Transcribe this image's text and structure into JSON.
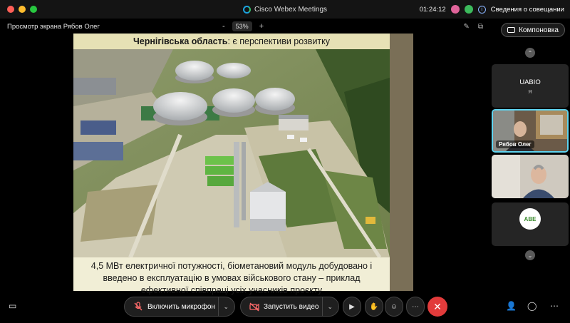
{
  "window": {
    "app_title": "Cisco Webex Meetings",
    "timer": "01:24:12",
    "meeting_info": "Сведения о совещании"
  },
  "share": {
    "label": "Просмотр экрана Рябов Олег",
    "zoom_minus": "-",
    "zoom_value": "53%",
    "zoom_plus": "+"
  },
  "layout_button": "Компоновка",
  "slide": {
    "title_bold": "Чернігівська область",
    "title_rest": ": є перспективи розвитку",
    "caption": [
      "4,5 МВт електричної потужності, біометановий модуль добудовано і",
      "введено в експлуатацію в умовах військового стану – приклад",
      "ефективної співпраці усіх учасників проєкту"
    ]
  },
  "participants": [
    {
      "name": "UABIO",
      "sub": "Я"
    },
    {
      "name": "Рябов Олег"
    },
    {
      "name": ""
    },
    {
      "name": "",
      "logo_text": "ABE"
    }
  ],
  "toolbar": {
    "mic_label": "Включить микрофон",
    "video_label": "Запустить видео"
  },
  "icons": {
    "chevron_up": "chevron-up-icon",
    "chevron_down": "chevron-down-icon",
    "end": "close-icon"
  },
  "colors": {
    "end_button": "#e23b3b",
    "active_border": "#5fd4f0",
    "slide_title_bg": "#e6e1b5",
    "slide_bg": "#f1eed6"
  }
}
